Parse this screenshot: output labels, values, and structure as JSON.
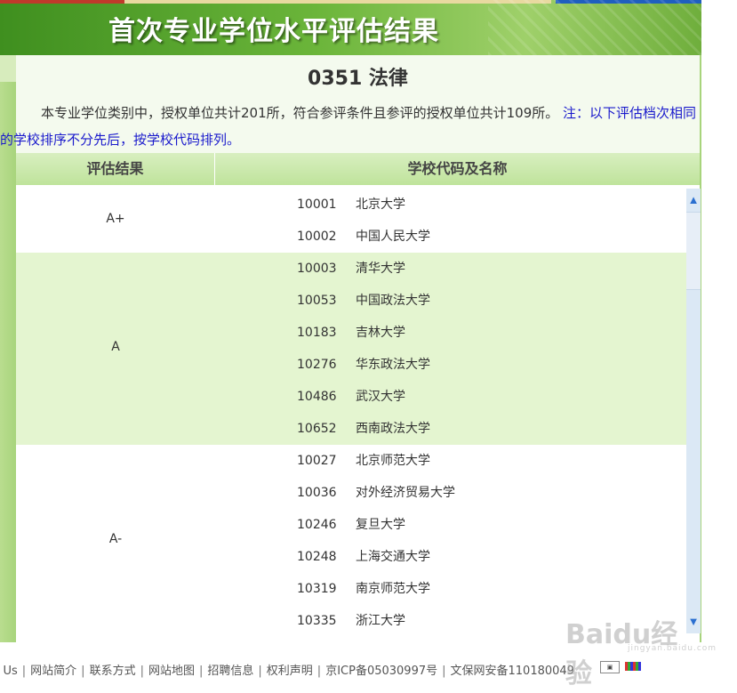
{
  "banner": {
    "title": "首次专业学位水平评估结果",
    "colors": {
      "accent": "#6bb53a",
      "dark": "#3f8f1f",
      "light": "#e4f5d0"
    }
  },
  "major": {
    "title": "0351  法律"
  },
  "description": {
    "text": "本专业学位类别中，授权单位共计201所，符合参评条件且参评的授权单位共计109所。",
    "note": "注：以下评估档次相同的学校排序不分先后，按学校代码排列。"
  },
  "table": {
    "headers": [
      "评估结果",
      "学校代码及名称"
    ],
    "groups": [
      {
        "grade": "A+",
        "schools": [
          {
            "code": "10001",
            "name": "北京大学"
          },
          {
            "code": "10002",
            "name": "中国人民大学"
          }
        ]
      },
      {
        "grade": "A",
        "schools": [
          {
            "code": "10003",
            "name": "清华大学"
          },
          {
            "code": "10053",
            "name": "中国政法大学"
          },
          {
            "code": "10183",
            "name": "吉林大学"
          },
          {
            "code": "10276",
            "name": "华东政法大学"
          },
          {
            "code": "10486",
            "name": "武汉大学"
          },
          {
            "code": "10652",
            "name": "西南政法大学"
          }
        ]
      },
      {
        "grade": "A-",
        "schools": [
          {
            "code": "10027",
            "name": "北京师范大学"
          },
          {
            "code": "10036",
            "name": "对外经济贸易大学"
          },
          {
            "code": "10246",
            "name": "复旦大学"
          },
          {
            "code": "10248",
            "name": "上海交通大学"
          },
          {
            "code": "10319",
            "name": "南京师范大学"
          },
          {
            "code": "10335",
            "name": "浙江大学"
          }
        ]
      }
    ]
  },
  "scrollbar": {
    "up_icon": "chevron-up-icon",
    "down_icon": "chevron-down-icon"
  },
  "footer": {
    "links": [
      "ut Us",
      "网站简介",
      "联系方式",
      "网站地图",
      "招聘信息",
      "权利声明"
    ],
    "icp": "京ICP备05030997号",
    "security": "文保网安备110180049"
  },
  "watermark": {
    "text": "Baidu经验",
    "sub": "jingyan.baidu.com"
  }
}
